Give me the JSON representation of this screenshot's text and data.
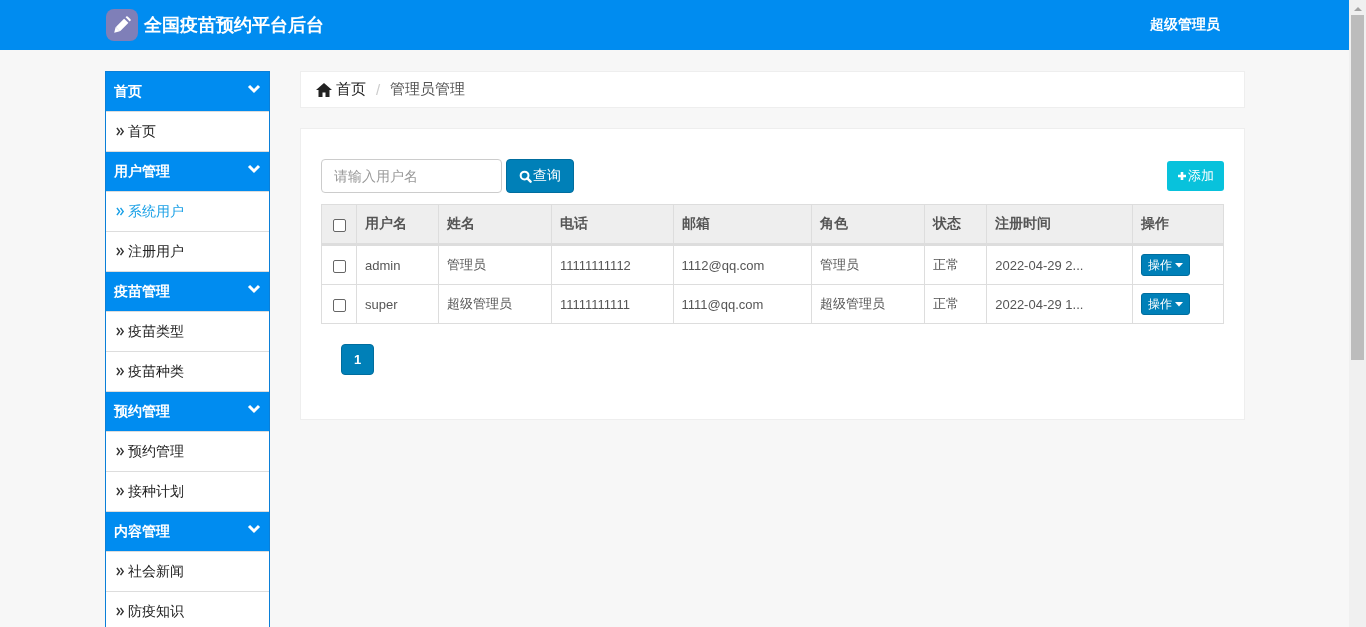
{
  "header": {
    "title": "全国疫苗预约平台后台",
    "user": "超级管理员"
  },
  "sidebar": {
    "groups": [
      {
        "label": "首页",
        "expanded": true,
        "items": [
          {
            "label": "首页",
            "selected": false
          }
        ]
      },
      {
        "label": "用户管理",
        "expanded": true,
        "items": [
          {
            "label": "系统用户",
            "selected": true
          },
          {
            "label": "注册用户",
            "selected": false
          }
        ]
      },
      {
        "label": "疫苗管理",
        "expanded": true,
        "items": [
          {
            "label": "疫苗类型",
            "selected": false
          },
          {
            "label": "疫苗种类",
            "selected": false
          }
        ]
      },
      {
        "label": "预约管理",
        "expanded": true,
        "items": [
          {
            "label": "预约管理",
            "selected": false
          },
          {
            "label": "接种计划",
            "selected": false
          }
        ]
      },
      {
        "label": "内容管理",
        "expanded": true,
        "items": [
          {
            "label": "社会新闻",
            "selected": false
          },
          {
            "label": "防疫知识",
            "selected": false
          }
        ]
      }
    ]
  },
  "breadcrumb_separator": "/",
  "breadcrumb": [
    {
      "label": "首页",
      "kind": "home"
    },
    {
      "label": "管理员管理",
      "kind": "current"
    }
  ],
  "search": {
    "placeholder": "请输入用户名",
    "button": "查询"
  },
  "add_button": "添加",
  "table": {
    "select_all_checked": false,
    "columns": [
      "用户名",
      "姓名",
      "电话",
      "邮箱",
      "角色",
      "状态",
      "注册时间",
      "操作"
    ],
    "rows": [
      {
        "checked": false,
        "cells": [
          "admin",
          "管理员",
          "11111111112",
          "1112@qq.com",
          "管理员",
          "正常",
          "2022-04-29 2..."
        ],
        "action": "操作"
      },
      {
        "checked": false,
        "cells": [
          "super",
          "超级管理员",
          "11111111111",
          "1111@qq.com",
          "超级管理员",
          "正常",
          "2022-04-29 1..."
        ],
        "action": "操作"
      }
    ]
  },
  "pagination": [
    {
      "label": "1",
      "selected": true
    }
  ]
}
